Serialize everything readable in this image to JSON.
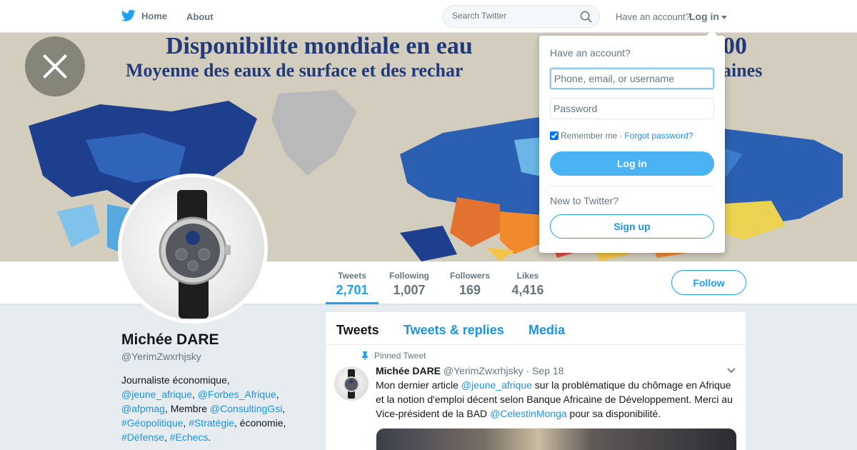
{
  "topbar": {
    "home_label": "Home",
    "about_label": "About",
    "search_placeholder": "Search Twitter",
    "have_account": "Have an account?",
    "login_label": "Log in"
  },
  "banner": {
    "title": "Disponibilite mondiale en eau",
    "title_tail": "00",
    "subtitle": "Moyenne des eaux de surface et des rechar",
    "subtitle_tail": "aines"
  },
  "profile": {
    "name": "Michée DARE",
    "handle": "@YerimZwxrhjsky",
    "bio": {
      "p1": "Journaliste économique,",
      "l1": "@jeune_afrique",
      "sep1": ", ",
      "l2": "@Forbes_Afrique",
      "sep2": ",",
      "l3": "@afpmag",
      "sep3": ", Membre ",
      "l4": "@ConsultingGsi",
      "sep4": ",",
      "l5": "#Géopolitique",
      "sep5": ", ",
      "l6": "#Stratégie",
      "sep6": ", économie,",
      "l7": "#Défense",
      "sep7": ", ",
      "l8": "#Echecs",
      "end": "."
    }
  },
  "stats": [
    {
      "label": "Tweets",
      "value": "2,701"
    },
    {
      "label": "Following",
      "value": "1,007"
    },
    {
      "label": "Followers",
      "value": "169"
    },
    {
      "label": "Likes",
      "value": "4,416"
    }
  ],
  "follow_label": "Follow",
  "timeline": {
    "tabs": [
      "Tweets",
      "Tweets & replies",
      "Media"
    ],
    "tweet": {
      "pinned": "Pinned Tweet",
      "name": "Michée DARE",
      "handle": "@YerimZwxrhjsky",
      "dot": "·",
      "date": "Sep 18",
      "t1": "Mon dernier article ",
      "l1": "@jeune_afrique",
      "t2": " sur la problématique du chômage en Afrique et la notion d'emploi décent selon Banque Africaine de Développement. Merci au Vice-président de la BAD ",
      "l2": "@CelestinMonga",
      "t3": "  pour sa disponibilité."
    }
  },
  "login_dropdown": {
    "title": "Have an account?",
    "username_placeholder": "Phone, email, or username",
    "password_placeholder": "Password",
    "remember": "Remember me",
    "dot": " · ",
    "forgot": "Forgot password?",
    "login_button": "Log in",
    "new_to": "New to Twitter?",
    "signup_button": "Sign up"
  },
  "colors": {
    "accent": "#1da1f2",
    "link": "#1b95e0",
    "login_button": "#4ab3f4",
    "background": "#e6ecf0"
  }
}
